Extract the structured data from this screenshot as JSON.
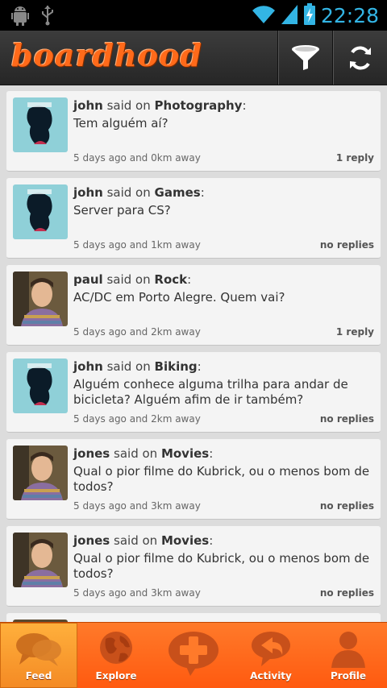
{
  "status_bar": {
    "time": "22:28"
  },
  "app": {
    "logo_text": "boardhood"
  },
  "posts": [
    {
      "user": "john",
      "said_on": "said on",
      "board": "Photography",
      "message": "Tem alguém aí?",
      "meta": "5 days ago and 0km away",
      "replies": "1 reply",
      "avatar": "poster-avatar"
    },
    {
      "user": "john",
      "said_on": "said on",
      "board": "Games",
      "message": "Server para CS?",
      "meta": "5 days ago and 1km away",
      "replies": "no replies",
      "avatar": "poster-avatar"
    },
    {
      "user": "paul",
      "said_on": "said on",
      "board": "Rock",
      "message": "AC/DC em Porto Alegre. Quem vai?",
      "meta": "5 days ago and 2km away",
      "replies": "1 reply",
      "avatar": "person-avatar"
    },
    {
      "user": "john",
      "said_on": "said on",
      "board": "Biking",
      "message": "Alguém conhece alguma trilha para andar de bicicleta? Alguém afim de ir também?",
      "meta": "5 days ago and 2km away",
      "replies": "no replies",
      "avatar": "poster-avatar"
    },
    {
      "user": "jones",
      "said_on": "said on",
      "board": "Movies",
      "message": "Qual o pior filme do Kubrick, ou o menos bom de todos?",
      "meta": "5 days ago and 3km away",
      "replies": "no replies",
      "avatar": "person-avatar"
    },
    {
      "user": "jones",
      "said_on": "said on",
      "board": "Movies",
      "message": "Qual o pior filme do Kubrick, ou o menos bom de todos?",
      "meta": "5 days ago and 3km away",
      "replies": "no replies",
      "avatar": "person-avatar"
    }
  ],
  "tabs": [
    {
      "label": "Feed",
      "icon": "speech-bubbles-icon",
      "active": true
    },
    {
      "label": "Explore",
      "icon": "globe-icon",
      "active": false
    },
    {
      "label": "",
      "icon": "add-post-icon",
      "active": false
    },
    {
      "label": "Activity",
      "icon": "reply-arrow-icon",
      "active": false
    },
    {
      "label": "Profile",
      "icon": "person-icon",
      "active": false
    }
  ],
  "colors": {
    "accent": "#ff6a1a",
    "status_time": "#33b5e5",
    "tab_active": "#f48a24"
  }
}
